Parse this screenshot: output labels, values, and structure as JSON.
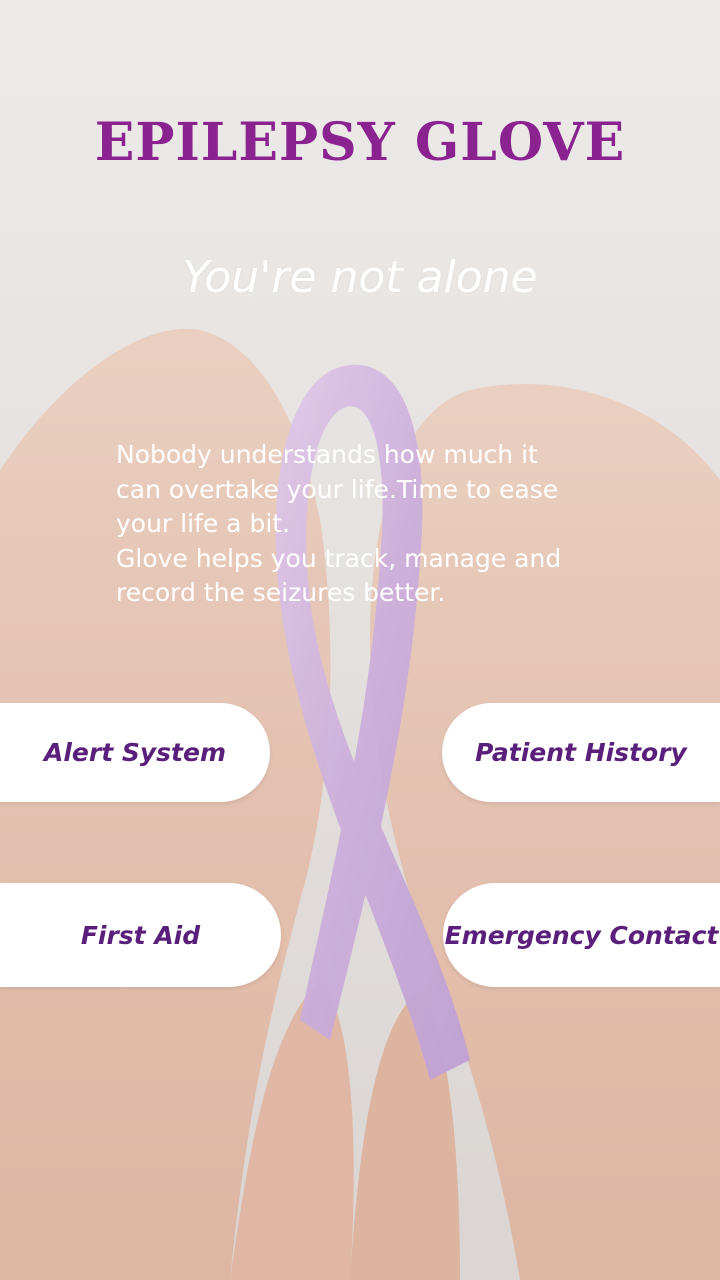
{
  "app": {
    "title": "EPILEPSY GLOVE",
    "tagline": "You're not alone",
    "description": "Nobody understands how much it can overtake your life.Time to ease your life a bit.\nGlove helps you track, manage and record the seizures better."
  },
  "buttons": {
    "alert_system": "Alert System",
    "patient_history": "Patient History",
    "first_aid": "First Aid",
    "emergency_contact": "Emergency Contact"
  },
  "colors": {
    "title": "#8a2290",
    "button_text": "#5a1f7a",
    "button_bg": "#ffffff",
    "ribbon": "#c9a8d8"
  },
  "background_image": "hands-holding-lavender-ribbon"
}
